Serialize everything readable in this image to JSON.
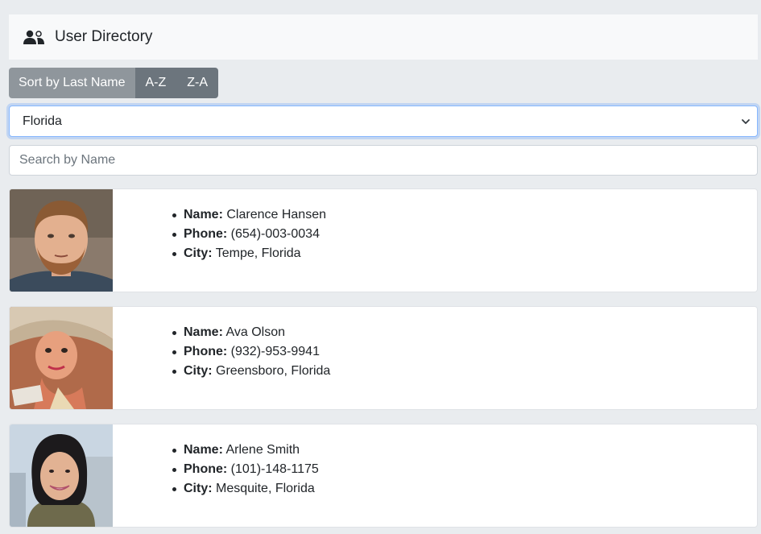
{
  "header": {
    "title": "User Directory",
    "icon": "users-icon"
  },
  "sort": {
    "label": "Sort by Last Name",
    "asc": "A-Z",
    "desc": "Z-A"
  },
  "filter": {
    "selected": "Florida"
  },
  "search": {
    "placeholder": "Search by Name"
  },
  "field_labels": {
    "name": "Name:",
    "phone": "Phone:",
    "city": "City:"
  },
  "users": [
    {
      "name": "Clarence Hansen",
      "phone": "(654)-003-0034",
      "city": "Tempe, Florida",
      "photo": "man-with-beard-photo"
    },
    {
      "name": "Ava Olson",
      "phone": "(932)-953-9941",
      "city": "Greensboro, Florida",
      "photo": "woman-with-sunhat-photo"
    },
    {
      "name": "Arlene Smith",
      "phone": "(101)-148-1175",
      "city": "Mesquite, Florida",
      "photo": "woman-smiling-photo"
    }
  ],
  "colors": {
    "background": "#e9ecef",
    "header_bg": "#f8f9fa",
    "button_dark": "#6c757d",
    "button_label": "#8f969c",
    "focus_border": "#86b7fe"
  }
}
